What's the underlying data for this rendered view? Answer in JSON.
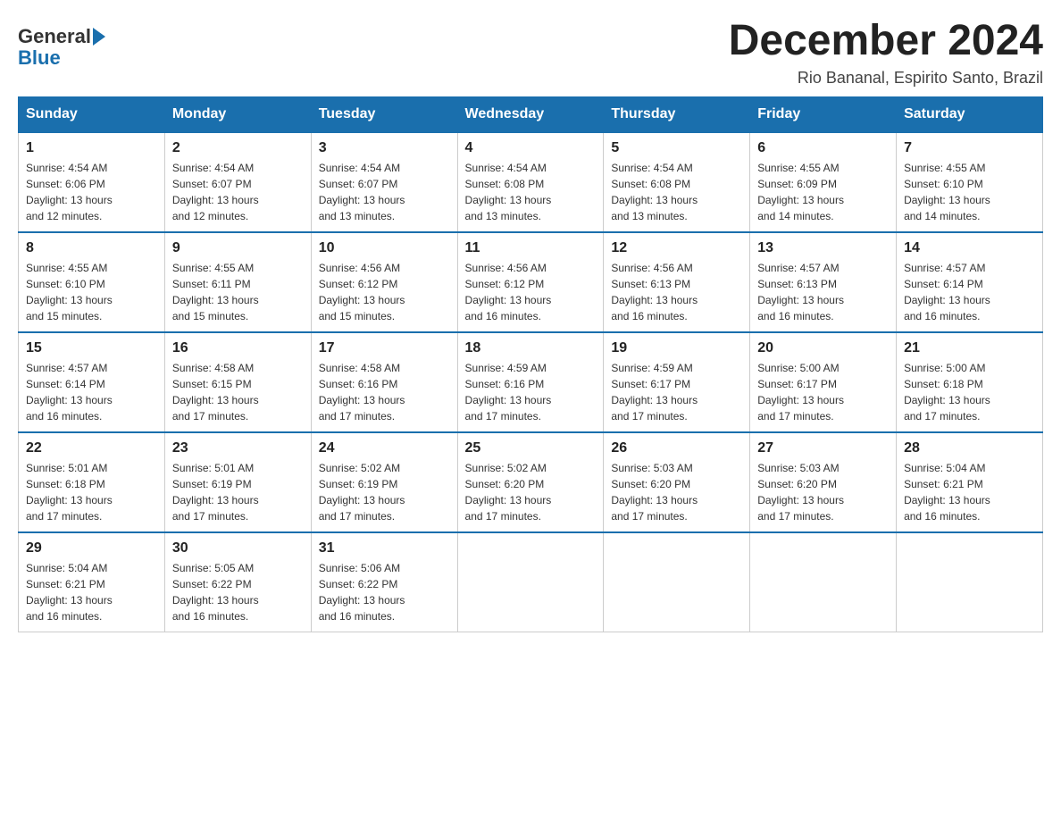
{
  "logo": {
    "general": "General",
    "blue": "Blue"
  },
  "title": "December 2024",
  "location": "Rio Bananal, Espirito Santo, Brazil",
  "days_of_week": [
    "Sunday",
    "Monday",
    "Tuesday",
    "Wednesday",
    "Thursday",
    "Friday",
    "Saturday"
  ],
  "weeks": [
    [
      {
        "day": "1",
        "sunrise": "4:54 AM",
        "sunset": "6:06 PM",
        "daylight": "13 hours and 12 minutes."
      },
      {
        "day": "2",
        "sunrise": "4:54 AM",
        "sunset": "6:07 PM",
        "daylight": "13 hours and 12 minutes."
      },
      {
        "day": "3",
        "sunrise": "4:54 AM",
        "sunset": "6:07 PM",
        "daylight": "13 hours and 13 minutes."
      },
      {
        "day": "4",
        "sunrise": "4:54 AM",
        "sunset": "6:08 PM",
        "daylight": "13 hours and 13 minutes."
      },
      {
        "day": "5",
        "sunrise": "4:54 AM",
        "sunset": "6:08 PM",
        "daylight": "13 hours and 13 minutes."
      },
      {
        "day": "6",
        "sunrise": "4:55 AM",
        "sunset": "6:09 PM",
        "daylight": "13 hours and 14 minutes."
      },
      {
        "day": "7",
        "sunrise": "4:55 AM",
        "sunset": "6:10 PM",
        "daylight": "13 hours and 14 minutes."
      }
    ],
    [
      {
        "day": "8",
        "sunrise": "4:55 AM",
        "sunset": "6:10 PM",
        "daylight": "13 hours and 15 minutes."
      },
      {
        "day": "9",
        "sunrise": "4:55 AM",
        "sunset": "6:11 PM",
        "daylight": "13 hours and 15 minutes."
      },
      {
        "day": "10",
        "sunrise": "4:56 AM",
        "sunset": "6:12 PM",
        "daylight": "13 hours and 15 minutes."
      },
      {
        "day": "11",
        "sunrise": "4:56 AM",
        "sunset": "6:12 PM",
        "daylight": "13 hours and 16 minutes."
      },
      {
        "day": "12",
        "sunrise": "4:56 AM",
        "sunset": "6:13 PM",
        "daylight": "13 hours and 16 minutes."
      },
      {
        "day": "13",
        "sunrise": "4:57 AM",
        "sunset": "6:13 PM",
        "daylight": "13 hours and 16 minutes."
      },
      {
        "day": "14",
        "sunrise": "4:57 AM",
        "sunset": "6:14 PM",
        "daylight": "13 hours and 16 minutes."
      }
    ],
    [
      {
        "day": "15",
        "sunrise": "4:57 AM",
        "sunset": "6:14 PM",
        "daylight": "13 hours and 16 minutes."
      },
      {
        "day": "16",
        "sunrise": "4:58 AM",
        "sunset": "6:15 PM",
        "daylight": "13 hours and 17 minutes."
      },
      {
        "day": "17",
        "sunrise": "4:58 AM",
        "sunset": "6:16 PM",
        "daylight": "13 hours and 17 minutes."
      },
      {
        "day": "18",
        "sunrise": "4:59 AM",
        "sunset": "6:16 PM",
        "daylight": "13 hours and 17 minutes."
      },
      {
        "day": "19",
        "sunrise": "4:59 AM",
        "sunset": "6:17 PM",
        "daylight": "13 hours and 17 minutes."
      },
      {
        "day": "20",
        "sunrise": "5:00 AM",
        "sunset": "6:17 PM",
        "daylight": "13 hours and 17 minutes."
      },
      {
        "day": "21",
        "sunrise": "5:00 AM",
        "sunset": "6:18 PM",
        "daylight": "13 hours and 17 minutes."
      }
    ],
    [
      {
        "day": "22",
        "sunrise": "5:01 AM",
        "sunset": "6:18 PM",
        "daylight": "13 hours and 17 minutes."
      },
      {
        "day": "23",
        "sunrise": "5:01 AM",
        "sunset": "6:19 PM",
        "daylight": "13 hours and 17 minutes."
      },
      {
        "day": "24",
        "sunrise": "5:02 AM",
        "sunset": "6:19 PM",
        "daylight": "13 hours and 17 minutes."
      },
      {
        "day": "25",
        "sunrise": "5:02 AM",
        "sunset": "6:20 PM",
        "daylight": "13 hours and 17 minutes."
      },
      {
        "day": "26",
        "sunrise": "5:03 AM",
        "sunset": "6:20 PM",
        "daylight": "13 hours and 17 minutes."
      },
      {
        "day": "27",
        "sunrise": "5:03 AM",
        "sunset": "6:20 PM",
        "daylight": "13 hours and 17 minutes."
      },
      {
        "day": "28",
        "sunrise": "5:04 AM",
        "sunset": "6:21 PM",
        "daylight": "13 hours and 16 minutes."
      }
    ],
    [
      {
        "day": "29",
        "sunrise": "5:04 AM",
        "sunset": "6:21 PM",
        "daylight": "13 hours and 16 minutes."
      },
      {
        "day": "30",
        "sunrise": "5:05 AM",
        "sunset": "6:22 PM",
        "daylight": "13 hours and 16 minutes."
      },
      {
        "day": "31",
        "sunrise": "5:06 AM",
        "sunset": "6:22 PM",
        "daylight": "13 hours and 16 minutes."
      },
      null,
      null,
      null,
      null
    ]
  ],
  "labels": {
    "sunrise": "Sunrise:",
    "sunset": "Sunset:",
    "daylight": "Daylight:"
  }
}
